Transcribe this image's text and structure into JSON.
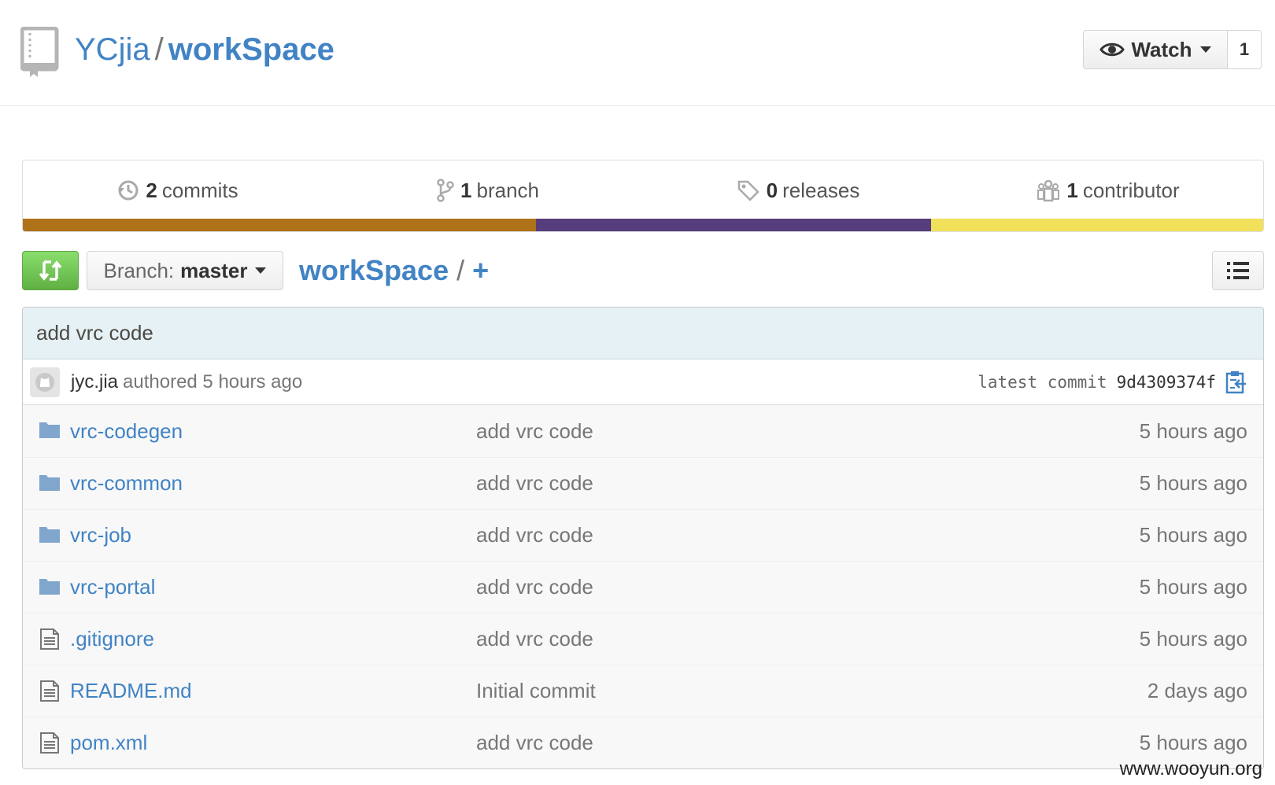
{
  "repo": {
    "owner": "YCjia",
    "separator": "/",
    "name": "workSpace"
  },
  "watch": {
    "label": "Watch",
    "count": "1"
  },
  "summary": {
    "commits": {
      "count": "2",
      "label": "commits"
    },
    "branches": {
      "count": "1",
      "label": "branch"
    },
    "releases": {
      "count": "0",
      "label": "releases"
    },
    "contributors": {
      "count": "1",
      "label": "contributor"
    }
  },
  "languages": [
    {
      "color": "#b07219",
      "percent": 41.4
    },
    {
      "color": "#563d7c",
      "percent": 31.8
    },
    {
      "color": "#f1e05a",
      "percent": 26.8
    }
  ],
  "branch": {
    "label": "Branch:",
    "value": "master"
  },
  "breadcrumb": {
    "root": "workSpace",
    "separator": "/",
    "plus": "+"
  },
  "commit": {
    "message": "add vrc code",
    "author": "jyc.jia",
    "authored": "authored 5 hours ago",
    "latest_label": "latest commit",
    "sha": "9d4309374f"
  },
  "files": [
    {
      "type": "folder",
      "name": "vrc-codegen",
      "message": "add vrc code",
      "age": "5 hours ago"
    },
    {
      "type": "folder",
      "name": "vrc-common",
      "message": "add vrc code",
      "age": "5 hours ago"
    },
    {
      "type": "folder",
      "name": "vrc-job",
      "message": "add vrc code",
      "age": "5 hours ago"
    },
    {
      "type": "folder",
      "name": "vrc-portal",
      "message": "add vrc code",
      "age": "5 hours ago"
    },
    {
      "type": "file",
      "name": ".gitignore",
      "message": "add vrc code",
      "age": "5 hours ago"
    },
    {
      "type": "file",
      "name": "README.md",
      "message": "Initial commit",
      "age": "2 days ago"
    },
    {
      "type": "file",
      "name": "pom.xml",
      "message": "add vrc code",
      "age": "5 hours ago"
    }
  ],
  "watermark": "www.wooyun.org"
}
